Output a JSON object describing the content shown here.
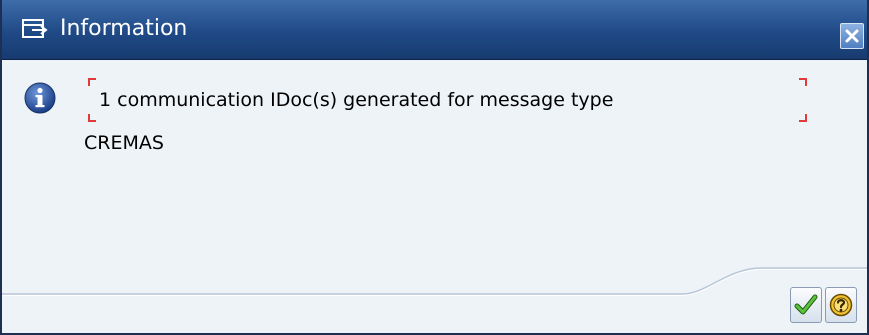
{
  "dialog": {
    "title": "Information",
    "title_icon": "dialog-window-icon",
    "close_icon": "close-icon"
  },
  "message": {
    "icon": "information-icon",
    "line1": "1 communication IDoc(s) generated for message type",
    "line2": "CREMAS"
  },
  "buttons": {
    "ok_icon": "checkmark-icon",
    "help_icon": "help-icon"
  },
  "colors": {
    "titlebar": "#1f4a86",
    "background": "#eef3f8",
    "info_blue": "#2956a8",
    "ok_green": "#3c9a2c",
    "help_gold": "#d7a30f",
    "focus_red": "#e03a3a"
  }
}
